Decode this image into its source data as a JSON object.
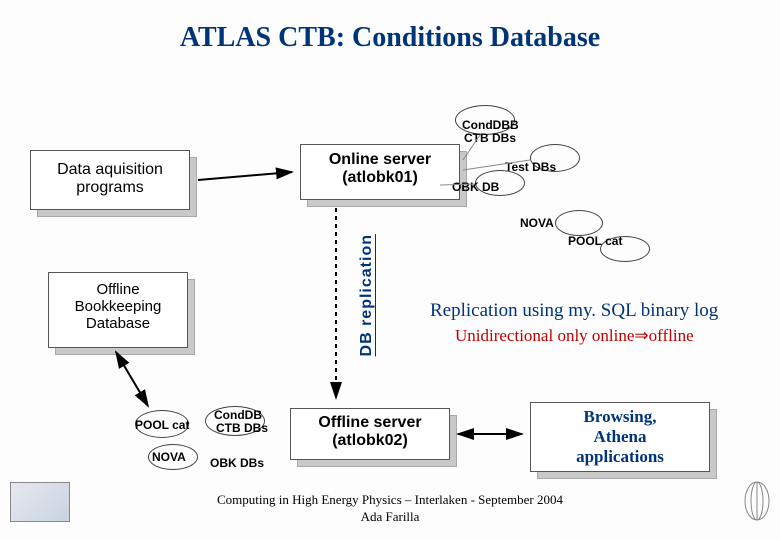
{
  "title": "ATLAS CTB: Conditions Database",
  "daq": {
    "line1": "Data aquisition",
    "line2": "programs"
  },
  "obk": {
    "line1": "Offline",
    "line2": "Bookkeeping",
    "line3": "Database"
  },
  "online": {
    "line1": "Online server",
    "line2": "(atlobk01)"
  },
  "offline": {
    "line1": "Offline server",
    "line2": "(atlobk02)"
  },
  "browsing": {
    "line1": "Browsing,",
    "line2": "Athena",
    "line3": "applications"
  },
  "labels": {
    "conddbb": "CondDBB",
    "ctbdbs_top": "CTB DBs",
    "testdbs": "Test DBs",
    "obkdb": "OBK DB",
    "nova_top": "NOVA",
    "poolcat_top": "POOL cat",
    "poolcat_bottom": "POOL cat",
    "conddb_bottom": "CondDB",
    "ctbdbs_bottom": "CTB DBs",
    "nova_bottom": "NOVA",
    "obkdbs_bottom": "OBK DBs"
  },
  "replication_label": "DB replication",
  "replication_text1": "Replication using my. SQL binary log",
  "replication_text2": "Unidirectional only online⇒offline",
  "footer": {
    "line1": "Computing in High Energy Physics – Interlaken - September 2004",
    "line2": "Ada Farilla"
  }
}
